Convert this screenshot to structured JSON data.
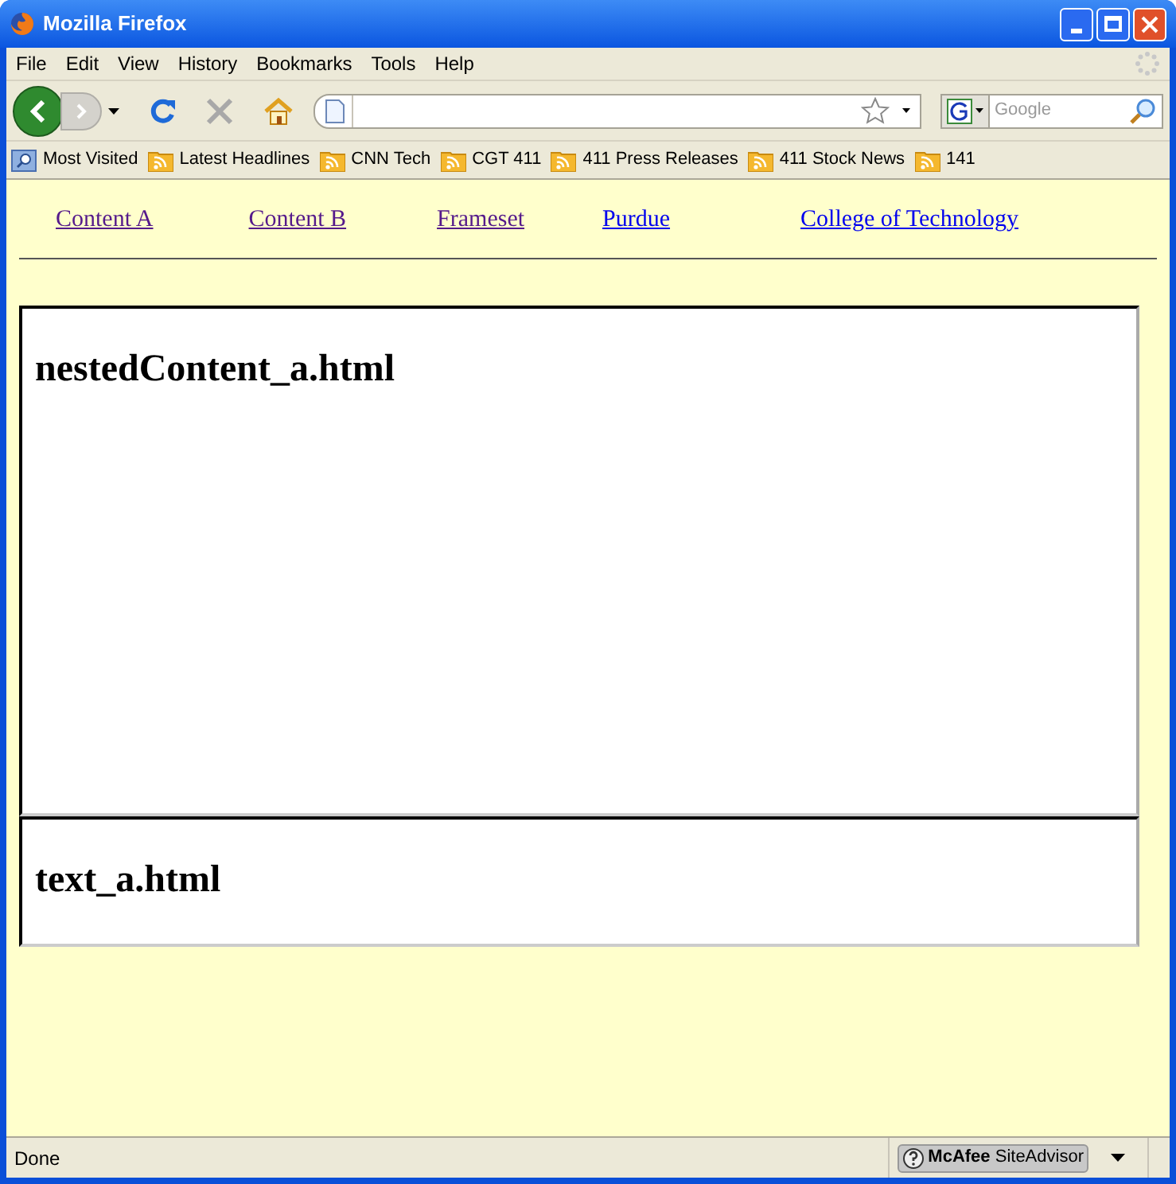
{
  "window": {
    "title": "Mozilla Firefox"
  },
  "menu": [
    "File",
    "Edit",
    "View",
    "History",
    "Bookmarks",
    "Tools",
    "Help"
  ],
  "search": {
    "placeholder": "Google"
  },
  "bookmarks": [
    {
      "label": "Most Visited",
      "kind": "search"
    },
    {
      "label": "Latest Headlines",
      "kind": "feed"
    },
    {
      "label": "CNN Tech",
      "kind": "feed"
    },
    {
      "label": "CGT 411",
      "kind": "feed"
    },
    {
      "label": "411 Press Releases",
      "kind": "feed"
    },
    {
      "label": "411 Stock News",
      "kind": "feed"
    },
    {
      "label": "141",
      "kind": "feed"
    }
  ],
  "nav_links": [
    {
      "label": "Content A",
      "visited": true
    },
    {
      "label": "Content B",
      "visited": true
    },
    {
      "label": "Frameset",
      "visited": true
    },
    {
      "label": "Purdue",
      "visited": false
    },
    {
      "label": "College of Technology",
      "visited": false
    }
  ],
  "frames": [
    {
      "heading": "nestedContent_a.html"
    },
    {
      "heading": "text_a.html"
    }
  ],
  "status_bar": {
    "text": "Done",
    "addon": "**McAfee** SiteAdvisor"
  }
}
